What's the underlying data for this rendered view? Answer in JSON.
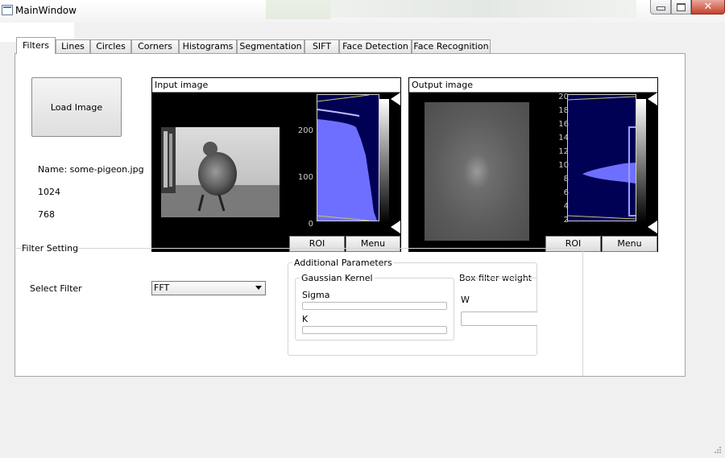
{
  "window": {
    "title": "MainWindow",
    "close_glyph": "✕"
  },
  "tabs": [
    {
      "label": "Filters",
      "active": true
    },
    {
      "label": "Lines"
    },
    {
      "label": "Circles"
    },
    {
      "label": "Corners"
    },
    {
      "label": "Histograms"
    },
    {
      "label": "Segmentation"
    },
    {
      "label": "SIFT"
    },
    {
      "label": "Face Detection"
    },
    {
      "label": "Face Recognition"
    }
  ],
  "load": {
    "label": "Load Image"
  },
  "info": {
    "name": "Name: some-pigeon.jpg",
    "width": "1024",
    "height": "768"
  },
  "input_pane": {
    "title": "Input image",
    "yticks": [
      "200",
      "100",
      "0"
    ],
    "roi_label": "ROI",
    "menu_label": "Menu"
  },
  "output_pane": {
    "title": "Output image",
    "yticks": [
      "20",
      "18",
      "16",
      "14",
      "12",
      "10",
      "8",
      "6",
      "4",
      "2"
    ],
    "roi_label": "ROI",
    "menu_label": "Menu"
  },
  "filter": {
    "section_title": "Filter Setting",
    "select_label": "Select Filter",
    "selected": "FFT"
  },
  "params": {
    "title": "Additional Parameters",
    "gaussian_title": "Gaussian Kernel",
    "sigma_label": "Sigma",
    "k_label": "K",
    "box_title": "Box filter weight",
    "w_label": "W"
  },
  "colors": {
    "histogram_bg": "#000054",
    "histogram_fill": "#6f6fff",
    "marker": "#c8c86a"
  }
}
